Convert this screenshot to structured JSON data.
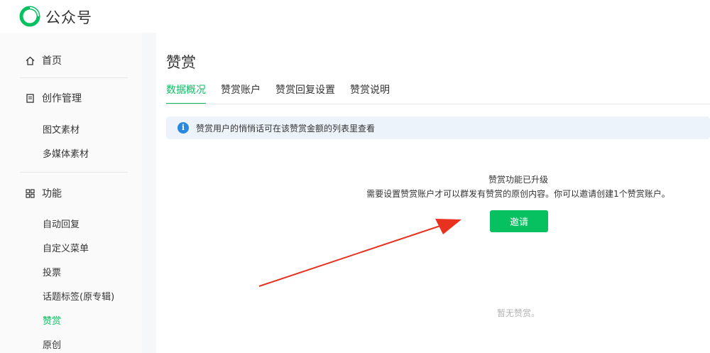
{
  "brand": {
    "name": "公众号"
  },
  "sidebar": {
    "home": "首页",
    "creation": "创作管理",
    "creation_items": [
      "图文素材",
      "多媒体素材"
    ],
    "features": "功能",
    "feature_items": [
      "自动回复",
      "自定义菜单",
      "投票",
      "话题标签(原专辑)",
      "赞赏",
      "原创"
    ],
    "active_item": "赞赏"
  },
  "main": {
    "title": "赞赏",
    "tabs": [
      "数据概况",
      "赞赏账户",
      "赞赏回复设置",
      "赞赏说明"
    ],
    "active_tab": "数据概况",
    "notice": "赞赏用户的悄悄话可在该赞赏金额的列表里查看",
    "upgrade_title": "赞赏功能已升级",
    "upgrade_desc": "需要设置赞赏账户才可以群发有赞赏的原创内容。你可以邀请创建1个赞赏账户。",
    "invite_label": "邀请",
    "empty_text": "暂无赞赏。"
  },
  "colors": {
    "accent": "#07c160",
    "notice_bg": "#edf3fa",
    "info_blue": "#2b88e0",
    "arrow": "#e8321f"
  },
  "icons": {
    "logo": "wechat-oa-logo-icon",
    "home": "home-icon",
    "creation": "document-icon",
    "features": "grid-icon",
    "info": "info-icon"
  }
}
